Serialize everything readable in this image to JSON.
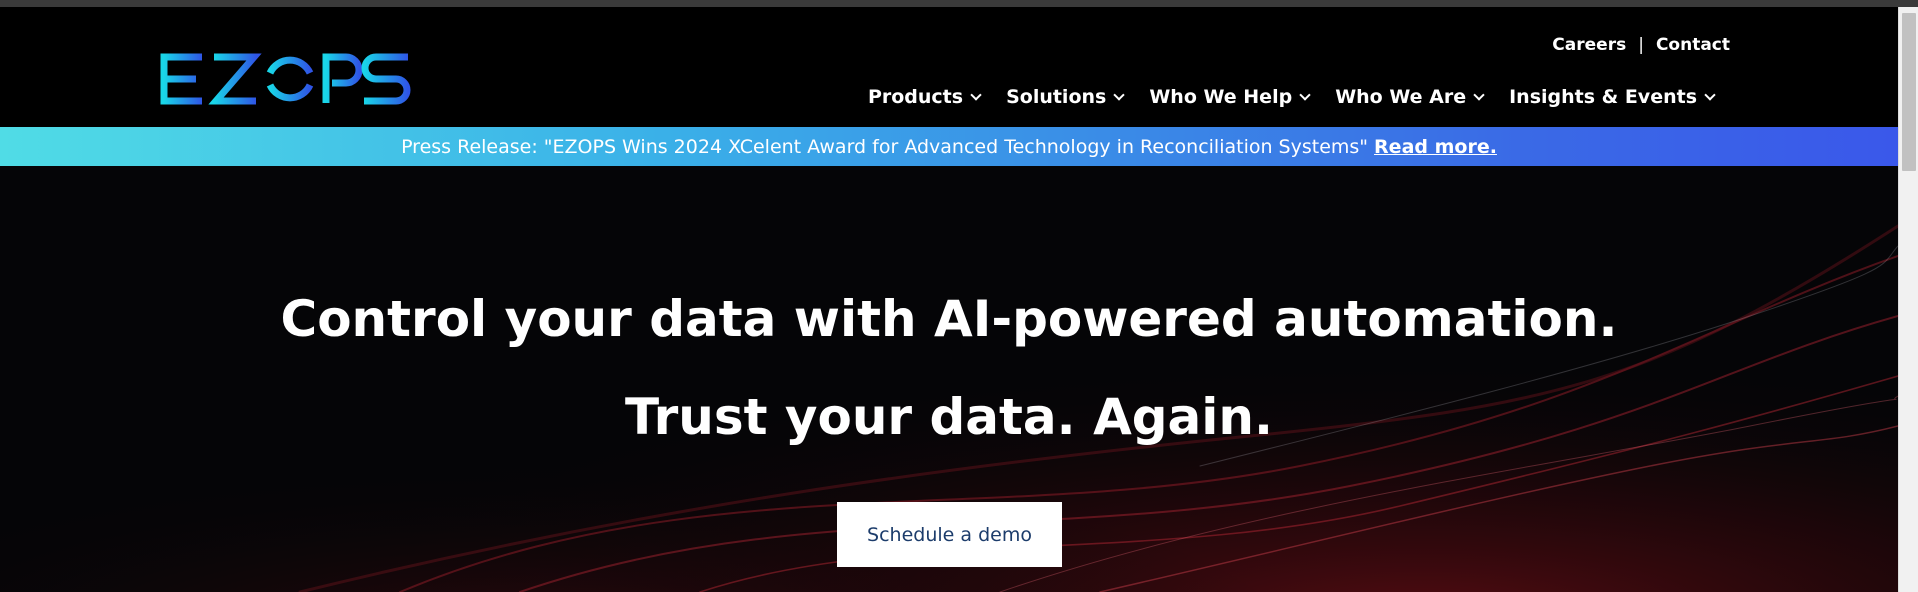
{
  "brand": {
    "logo_text": "EZOPS",
    "gradient_start": "#19d6e8",
    "gradient_end": "#2f55e6"
  },
  "utility_nav": {
    "careers": "Careers",
    "separator": "|",
    "contact": "Contact"
  },
  "main_nav": {
    "items": [
      {
        "label": "Products",
        "icon": "chevron-down-icon"
      },
      {
        "label": "Solutions",
        "icon": "chevron-down-icon"
      },
      {
        "label": "Who We Help",
        "icon": "chevron-down-icon"
      },
      {
        "label": "Who We Are",
        "icon": "chevron-down-icon"
      },
      {
        "label": "Insights & Events",
        "icon": "chevron-down-icon"
      }
    ]
  },
  "banner": {
    "text": "Press Release: \"EZOPS Wins 2024 XCelent Award for Advanced Technology in Reconciliation Systems\"",
    "link_label": "Read more."
  },
  "hero": {
    "headline": "Control your data with AI-powered automation.",
    "subheadline": "Trust your data. Again.",
    "cta_label": "Schedule a demo"
  },
  "colors": {
    "background": "#000000",
    "banner_start": "#50dce6",
    "banner_end": "#3a58ea",
    "cta_text": "#1c3c6b",
    "wave_accent": "#b3202e"
  }
}
